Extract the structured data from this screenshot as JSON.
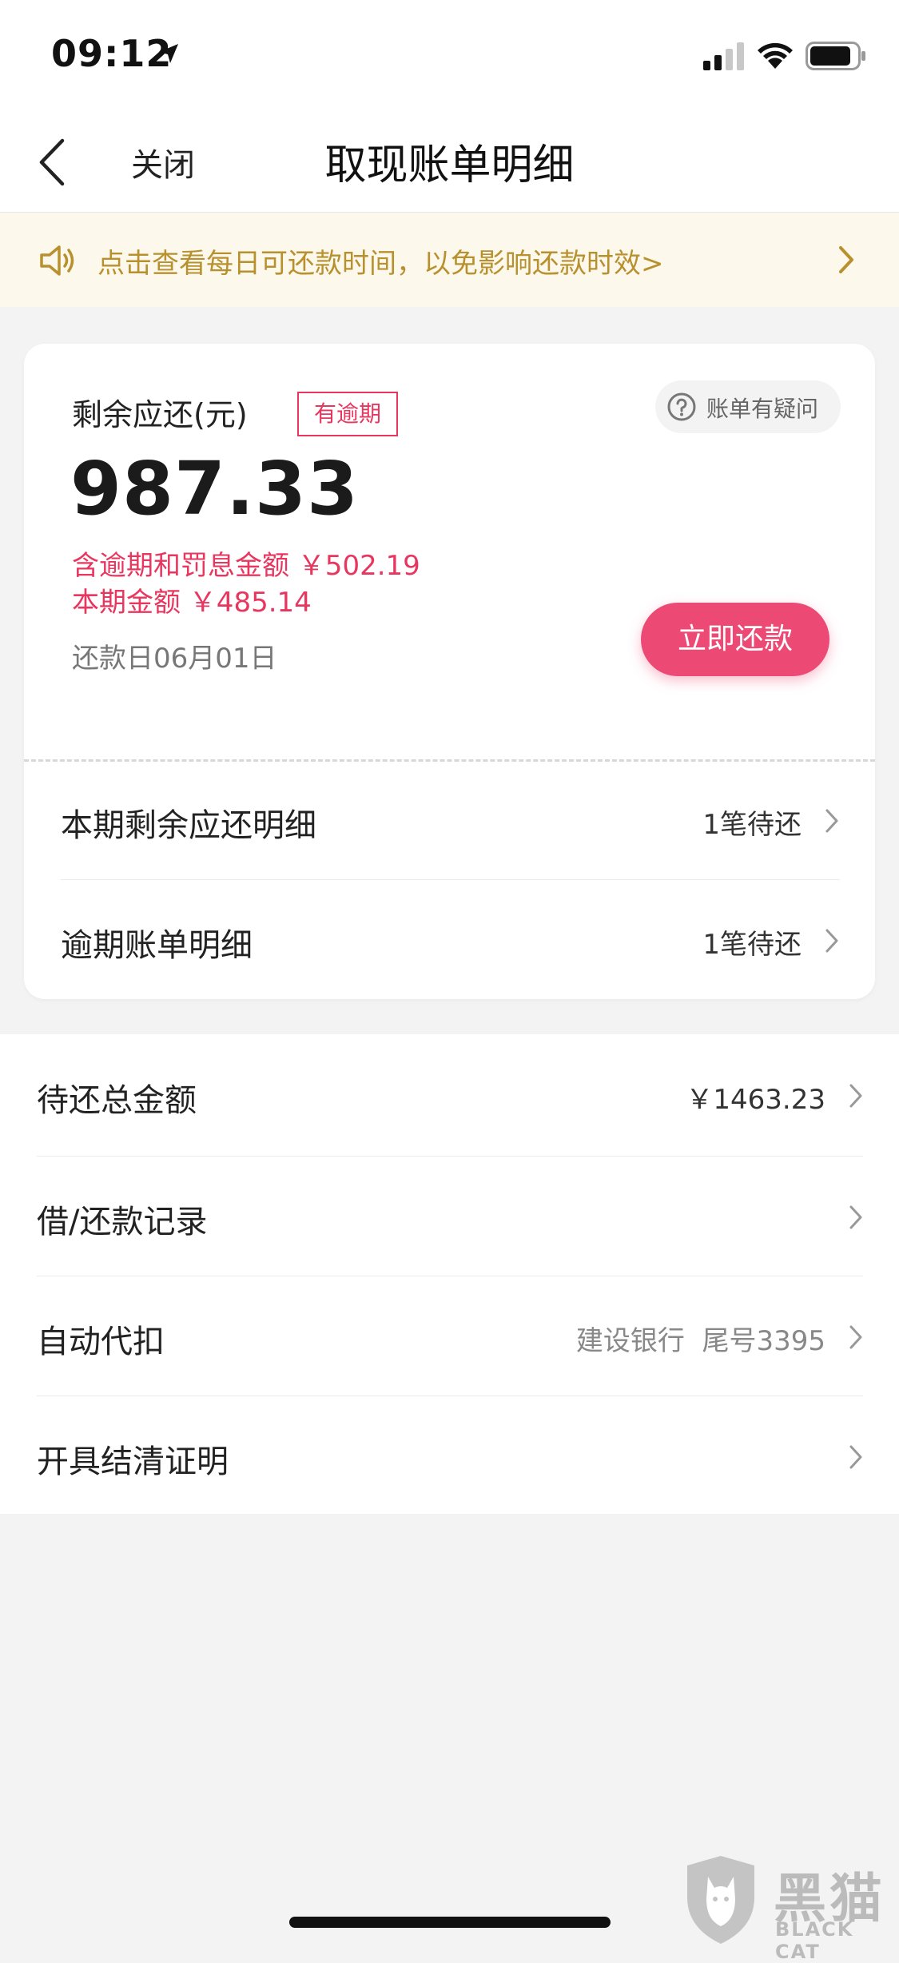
{
  "status_bar": {
    "time": "09:12",
    "icons": [
      "location-arrow-icon",
      "cellular-signal-icon",
      "wifi-icon",
      "battery-icon"
    ]
  },
  "nav": {
    "close_label": "关闭",
    "title": "取现账单明细",
    "back_icon": "chevron-left-icon"
  },
  "notice": {
    "text": "点击查看每日可还款时间，以免影响还款时效>",
    "icon": "speaker-icon",
    "color": "#b8912e",
    "background": "#fdf8ec"
  },
  "card": {
    "label": "剩余应还(元)",
    "badge": "有逾期",
    "query_label": "账单有疑问",
    "amount": "987.33",
    "overdue_line": "含逾期和罚息金额 ￥502.19",
    "current_line": "本期金额 ￥485.14",
    "due_date": "还款日06月01日",
    "pay_button": "立即还款",
    "accent_color": "#ec4a74",
    "rows": [
      {
        "label": "本期剩余应还明细",
        "value": "1笔待还"
      },
      {
        "label": "逾期账单明细",
        "value": "1笔待还"
      }
    ]
  },
  "list": {
    "rows": [
      {
        "label": "待还总金额",
        "value": "￥1463.23"
      },
      {
        "label": "借/还款记录",
        "value": ""
      },
      {
        "label": "自动代扣",
        "value": "建设银行  尾号3395"
      },
      {
        "label": "开具结清证明",
        "value": ""
      }
    ]
  },
  "watermark": {
    "cn": "黑猫",
    "en": "BLACK CAT"
  }
}
